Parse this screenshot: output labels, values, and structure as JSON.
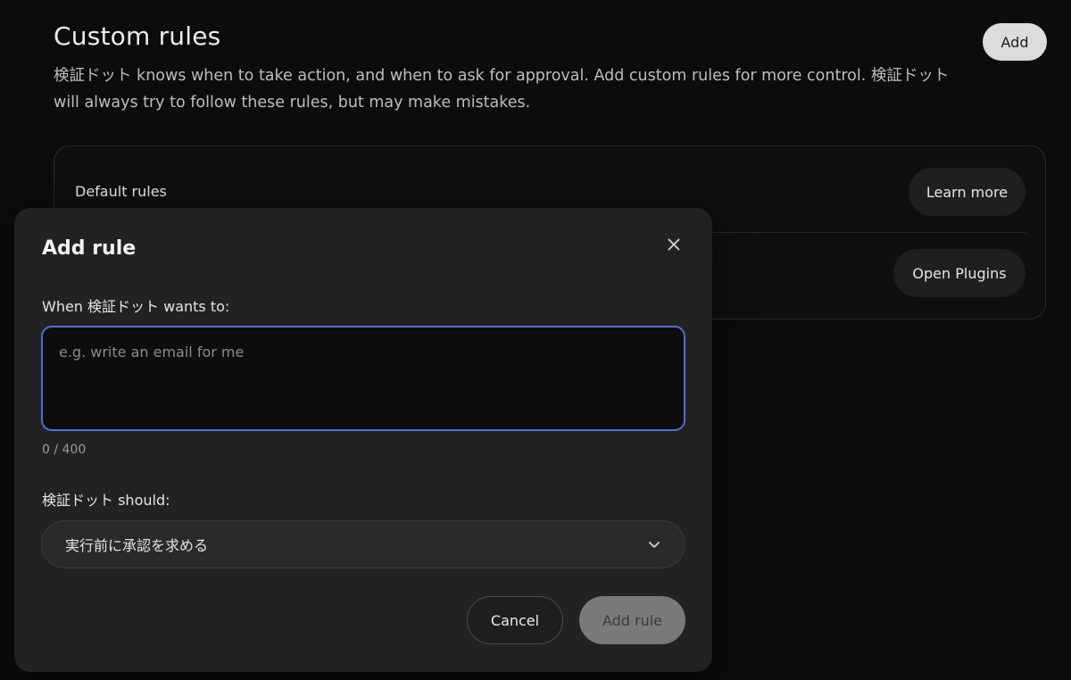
{
  "page": {
    "title": "Custom rules",
    "description": "検証ドット knows when to take action, and when to ask for approval. Add custom rules for more control. 検証ドット will always try to follow these rules, but may make mistakes.",
    "add_label": "Add"
  },
  "rules_card": {
    "default_rules_label": "Default rules",
    "learn_more_label": "Learn more",
    "open_plugins_label": "Open Plugins"
  },
  "modal": {
    "title": "Add rule",
    "close_icon": "close-icon",
    "when_label": "When 検証ドット wants to:",
    "when_input": {
      "value": "",
      "placeholder": "e.g. write an email for me"
    },
    "char_count": "0 / 400",
    "should_label": "検証ドット should:",
    "should_select": {
      "selected": "実行前に承認を求める",
      "icon": "chevron-down-icon"
    },
    "cancel_label": "Cancel",
    "add_rule_label": "Add rule"
  },
  "colors": {
    "background": "#0c0c0c",
    "modal_background": "#222222",
    "focus_border": "#4d6fd6",
    "primary_button_disabled": "#7a7a7a",
    "add_button": "#dcdcdc"
  }
}
